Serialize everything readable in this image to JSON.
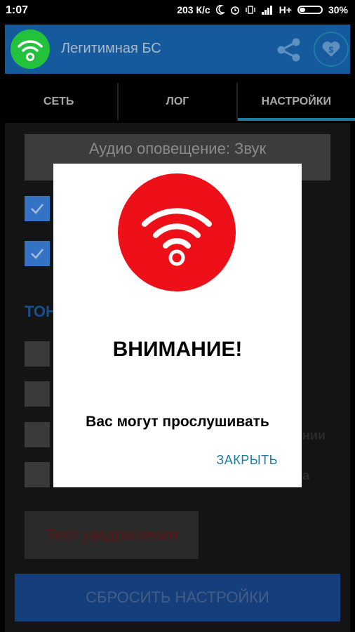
{
  "status_bar": {
    "time": "1:07",
    "network_speed": "203 К/с",
    "network_type": "H+",
    "battery_percent": "30%",
    "battery_level": 0.3
  },
  "app_bar": {
    "title": "Легитимная БС",
    "logo_icon": "wifi-icon",
    "share_icon": "share-icon",
    "donate_icon": "donate-dollar-icon",
    "accent": "#145a9c"
  },
  "tabs": [
    {
      "label": "СЕТЬ",
      "active": false
    },
    {
      "label": "ЛОГ",
      "active": false
    },
    {
      "label": "НАСТРОЙКИ",
      "active": true
    }
  ],
  "settings": {
    "audio_button": "Аудио оповещение: Звук",
    "section_fragment": "ТОН",
    "fragment_1": "нии",
    "fragment_2": "а",
    "test_button": "Тест уведомления",
    "reset_button": "СБРОСИТЬ НАСТРОЙКИ"
  },
  "dialog": {
    "icon": "wifi-alert-icon",
    "title": "ВНИМАНИЕ!",
    "message": "Вас могут прослушивать",
    "close_button": "ЗАКРЫТЬ",
    "icon_color": "#ee1018"
  }
}
